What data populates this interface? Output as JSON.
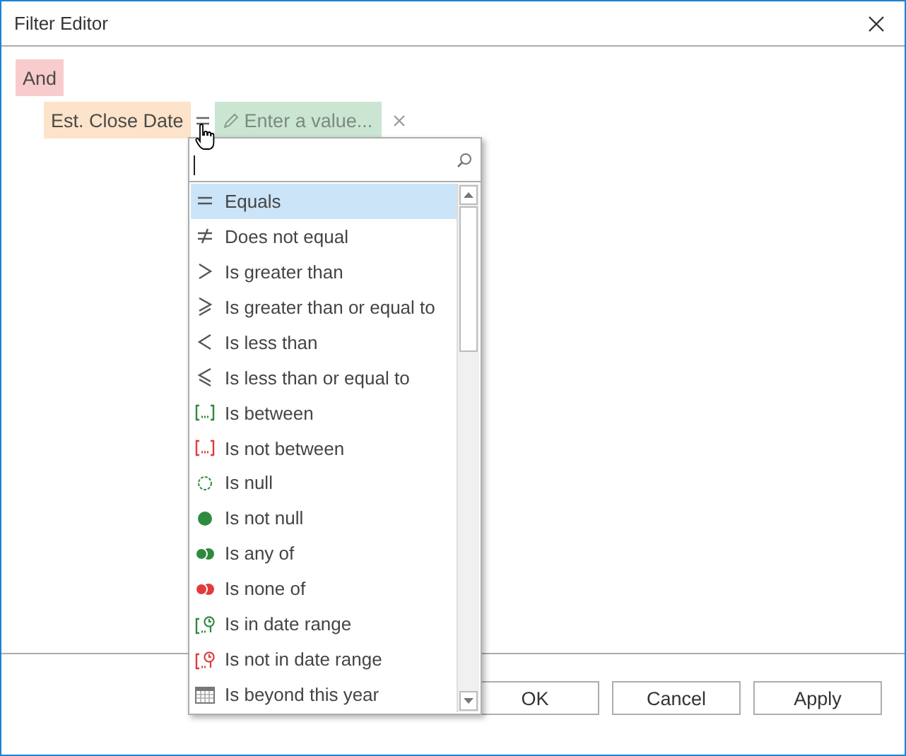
{
  "window": {
    "title": "Filter Editor"
  },
  "group": {
    "operator": "And",
    "conditions": [
      {
        "field": "Est. Close Date",
        "value_placeholder": "Enter a value..."
      }
    ]
  },
  "operator_menu": {
    "items": [
      {
        "label": "Equals",
        "kind": "equals",
        "selected": true
      },
      {
        "label": "Does not equal",
        "kind": "not-equal",
        "selected": false
      },
      {
        "label": "Is greater than",
        "kind": "greater",
        "selected": false
      },
      {
        "label": "Is greater than or equal to",
        "kind": "greater-equal",
        "selected": false
      },
      {
        "label": "Is less than",
        "kind": "less",
        "selected": false
      },
      {
        "label": "Is less than or equal to",
        "kind": "less-equal",
        "selected": false
      },
      {
        "label": "Is between",
        "kind": "between",
        "selected": false
      },
      {
        "label": "Is not between",
        "kind": "not-between",
        "selected": false
      },
      {
        "label": "Is null",
        "kind": "null",
        "selected": false
      },
      {
        "label": "Is not null",
        "kind": "not-null",
        "selected": false
      },
      {
        "label": "Is any of",
        "kind": "any-of",
        "selected": false
      },
      {
        "label": "Is none of",
        "kind": "none-of",
        "selected": false
      },
      {
        "label": "Is in date range",
        "kind": "in-date-range",
        "selected": false
      },
      {
        "label": "Is not in date range",
        "kind": "not-in-date-range",
        "selected": false
      },
      {
        "label": "Is beyond this year",
        "kind": "beyond-year",
        "selected": false
      }
    ]
  },
  "buttons": [
    "OK",
    "Cancel",
    "Apply"
  ]
}
